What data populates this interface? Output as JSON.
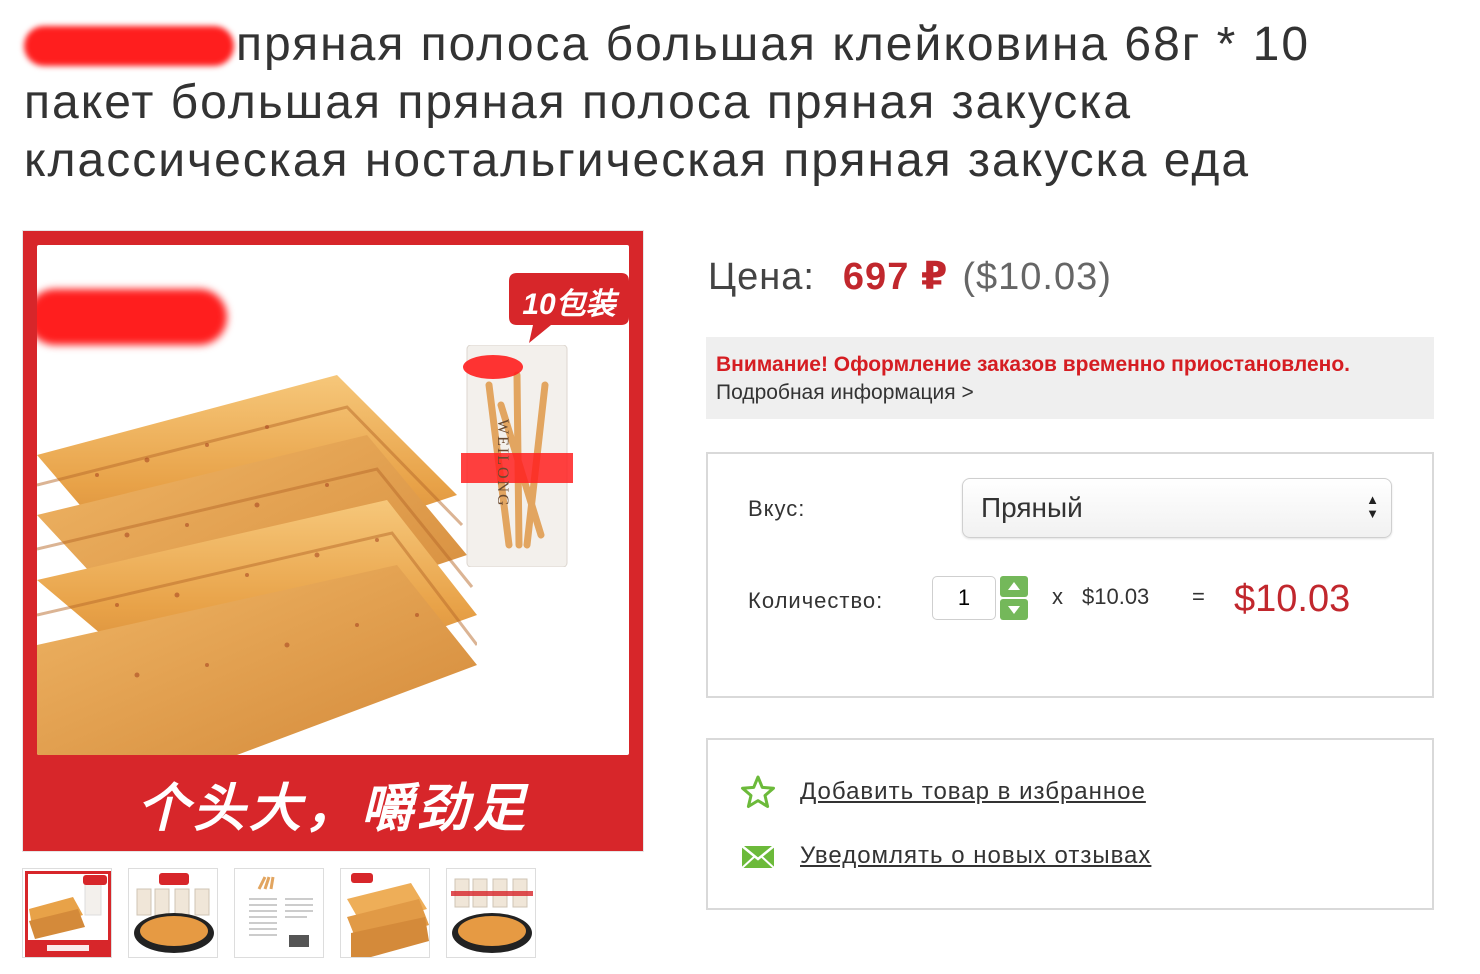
{
  "product": {
    "title": "пряная полоса большая клейковина 68г * 10 пакет большая пряная полоса пряная закуска классическая ностальгическая пряная закуска еда",
    "image": {
      "pack_badge": "10包装",
      "package_label": "WEILONG",
      "slogan": "个头大，嚼劲足"
    },
    "thumbnails": [
      {
        "name": "thumb-1"
      },
      {
        "name": "thumb-2"
      },
      {
        "name": "thumb-3"
      },
      {
        "name": "thumb-4"
      },
      {
        "name": "thumb-5"
      }
    ]
  },
  "price": {
    "label": "Цена:",
    "rub": "697 ₽",
    "usd": "($10.03)"
  },
  "notice": {
    "warning": "Внимание! Оформление заказов временно приостановлено.",
    "more_link": "Подробная информация >"
  },
  "options": {
    "flavor_label": "Вкус:",
    "flavor_value": "Пряный",
    "quantity_label": "Количество:",
    "quantity_value": "1",
    "times_sign": "x",
    "unit_price": "$10.03",
    "equals_sign": "=",
    "total": "$10.03"
  },
  "actions": {
    "favorite_label": "Добавить товар в избранное",
    "notify_label": "Уведомлять о новых отзывах"
  },
  "colors": {
    "accent_red": "#c1272d",
    "warning_red": "#d51d22",
    "image_red": "#d7262a",
    "stepper_green": "#74b85a"
  }
}
